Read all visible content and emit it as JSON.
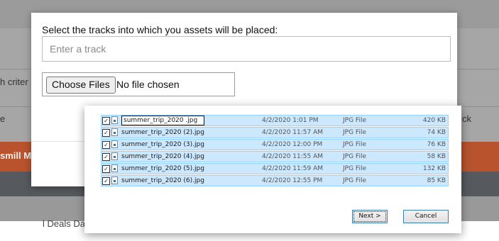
{
  "background": {
    "left_fragment_1": "h criter",
    "left_fragment_2": "e",
    "right_fragment": "ck",
    "orange_bar_text": "smill Ma",
    "lower_fragment": "l Deals Dat"
  },
  "modal": {
    "label": "Select the tracks into which you assets will be placed:",
    "track_placeholder": "Enter a track",
    "choose_files_label": "Choose Files",
    "no_file_text": "No file chosen"
  },
  "file_dialog": {
    "files": [
      {
        "name": "summer_trip_2020 .jpg",
        "date": "4/2/2020 1:01 PM",
        "type": "JPG File",
        "size": "420 KB",
        "checked": true,
        "editing": true
      },
      {
        "name": "summer_trip_2020 (2).jpg",
        "date": "4/2/2020 11:57 AM",
        "type": "JPG File",
        "size": "74 KB",
        "checked": true
      },
      {
        "name": "summer_trip_2020 (3).jpg",
        "date": "4/2/2020 12:00 PM",
        "type": "JPG File",
        "size": "76 KB",
        "checked": true
      },
      {
        "name": "summer_trip_2020 (4).jpg",
        "date": "4/2/2020 11:55 AM",
        "type": "JPG File",
        "size": "58 KB",
        "checked": true
      },
      {
        "name": "summer_trip_2020 (5).jpg",
        "date": "4/2/2020 11:59 AM",
        "type": "JPG File",
        "size": "132 KB",
        "checked": true
      },
      {
        "name": "summer_trip_2020 (6).jpg",
        "date": "4/2/2020 12:55 PM",
        "type": "JPG File",
        "size": "85 KB",
        "checked": true
      }
    ],
    "next_label": "Next >",
    "cancel_label": "Cancel"
  },
  "colors": {
    "selection": "#cce8ff",
    "orange_bar": "#b8532e",
    "dark_bar": "#565a5e"
  }
}
